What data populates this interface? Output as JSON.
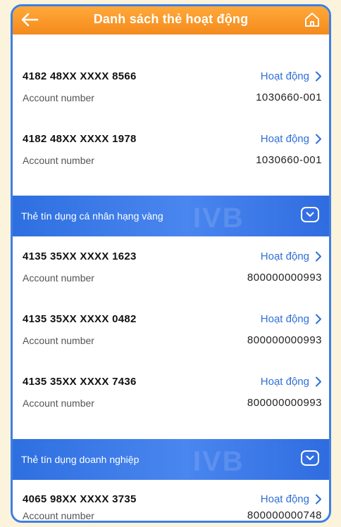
{
  "header": {
    "title": "Danh sách thẻ hoạt động"
  },
  "peek": {
    "label": "Account number",
    "value": "1030660-001"
  },
  "groups": [
    {
      "cards": [
        {
          "number": "4182 48XX XXXX 8566",
          "status": "Hoạt động",
          "account_label": "Account number",
          "account": "1030660-001"
        },
        {
          "number": "4182 48XX XXXX 1978",
          "status": "Hoạt động",
          "account_label": "Account number",
          "account": "1030660-001"
        }
      ]
    },
    {
      "title": "Thẻ tín dụng cá nhân hạng vàng",
      "watermark": "IVB",
      "cards": [
        {
          "number": "4135 35XX XXXX 1623",
          "status": "Hoạt động",
          "account_label": "Account number",
          "account": "800000000993"
        },
        {
          "number": "4135 35XX XXXX 0482",
          "status": "Hoạt động",
          "account_label": "Account number",
          "account": "800000000993"
        },
        {
          "number": "4135 35XX XXXX 7436",
          "status": "Hoạt động",
          "account_label": "Account number",
          "account": "800000000993"
        }
      ]
    },
    {
      "title": "Thẻ tín dụng doanh nghiệp",
      "watermark": "IVB",
      "cards": [
        {
          "number": "4065 98XX XXXX 3735",
          "status": "Hoạt động",
          "account_label": "Account number",
          "account": "800000000748"
        }
      ]
    }
  ],
  "colors": {
    "header": "#f58a1c",
    "accent": "#2f6fd8",
    "section": "#2e6fe0"
  },
  "icons": {
    "back": "arrow-left-icon",
    "home": "home-icon",
    "status": "chevron-right-icon",
    "toggle": "chevron-down-icon"
  }
}
